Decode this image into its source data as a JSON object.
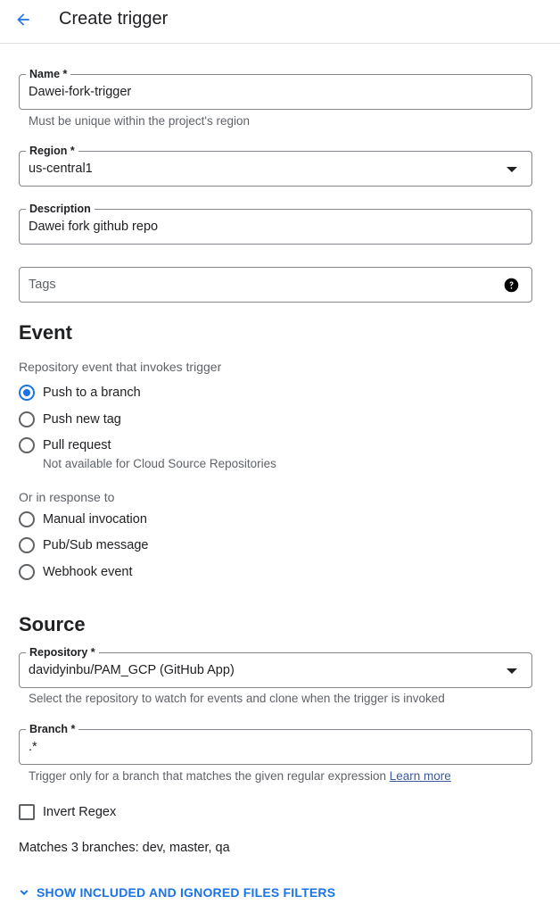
{
  "header": {
    "title": "Create trigger"
  },
  "name_field": {
    "label": "Name *",
    "value": "Dawei-fork-trigger",
    "hint": "Must be unique within the project's region"
  },
  "region_field": {
    "label": "Region *",
    "value": "us-central1"
  },
  "description_field": {
    "label": "Description",
    "value": "Dawei fork github repo"
  },
  "tags_field": {
    "placeholder": "Tags"
  },
  "event": {
    "title": "Event",
    "subtitle": "Repository event that invokes trigger",
    "options": [
      {
        "label": "Push to a branch",
        "checked": true
      },
      {
        "label": "Push new tag",
        "checked": false
      },
      {
        "label": "Pull request",
        "checked": false,
        "note": "Not available for Cloud Source Repositories"
      }
    ],
    "response_subtitle": "Or in response to",
    "response_options": [
      {
        "label": "Manual invocation",
        "checked": false
      },
      {
        "label": "Pub/Sub message",
        "checked": false
      },
      {
        "label": "Webhook event",
        "checked": false
      }
    ]
  },
  "source": {
    "title": "Source",
    "repository": {
      "label": "Repository *",
      "value": "davidyinbu/PAM_GCP (GitHub App)",
      "hint": "Select the repository to watch for events and clone when the trigger is invoked"
    },
    "branch": {
      "label": "Branch *",
      "value": ".*",
      "hint": "Trigger only for a branch that matches the given regular expression",
      "learn_more": "Learn more"
    },
    "invert_regex_label": "Invert Regex",
    "matches_text": "Matches 3 branches: dev, master, qa",
    "filters_link": "SHOW INCLUDED AND IGNORED FILES FILTERS"
  },
  "colors": {
    "accent": "#1a73e8",
    "text": "#202124",
    "muted": "#5f6368",
    "border": "#80868b"
  }
}
